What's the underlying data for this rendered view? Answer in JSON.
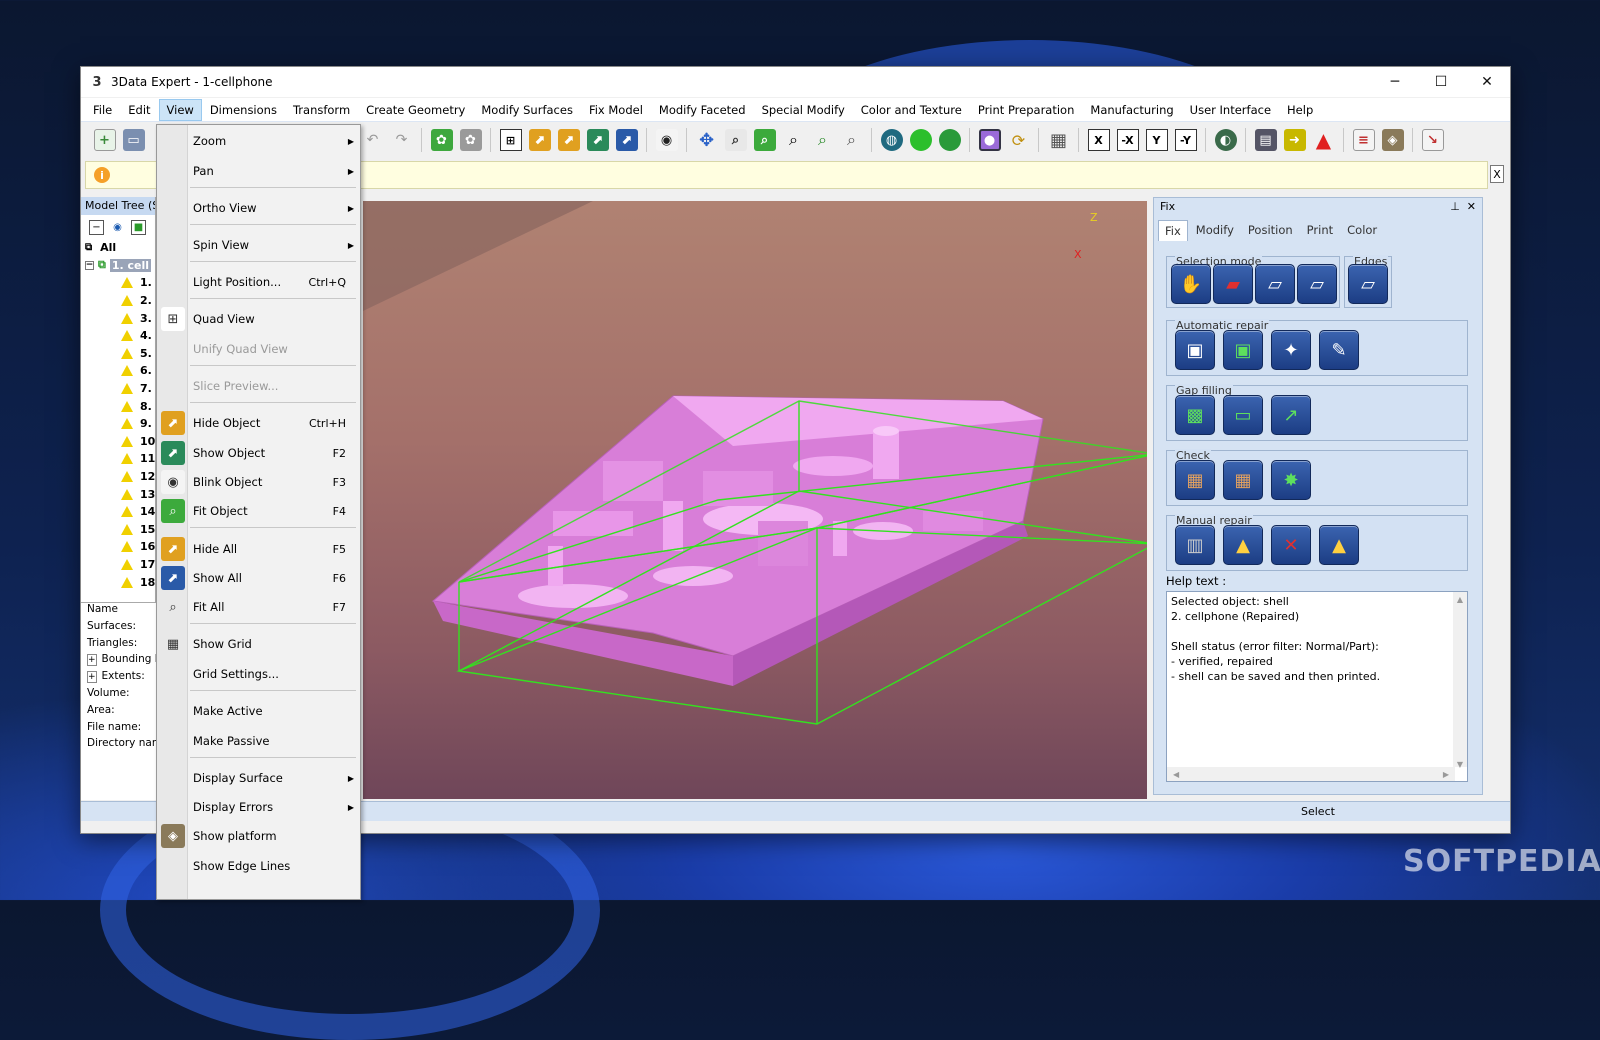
{
  "window": {
    "title": "3Data Expert - 1-cellphone",
    "minimize": "─",
    "maximize": "☐",
    "close": "✕"
  },
  "menu": [
    "File",
    "Edit",
    "View",
    "Dimensions",
    "Transform",
    "Create Geometry",
    "Modify Surfaces",
    "Fix Model",
    "Modify Faceted",
    "Special Modify",
    "Color and Texture",
    "Print Preparation",
    "Manufacturing",
    "User Interface",
    "Help"
  ],
  "toolbar": {
    "x": "X",
    "neg_x": "-X",
    "y": "Y",
    "neg_y": "-Y"
  },
  "infobar": {
    "icon": "i",
    "close": "X"
  },
  "tree": {
    "header": "Model Tree (Sh",
    "root": "All",
    "model": "1. cell",
    "items": [
      "1.",
      "2.",
      "3.",
      "4.",
      "5.",
      "6.",
      "7.",
      "8.",
      "9.",
      "10",
      "11",
      "12",
      "13",
      "14",
      "15",
      "16",
      "17",
      "18"
    ]
  },
  "properties": [
    "Name",
    "Surfaces:",
    "Triangles:",
    "Bounding b",
    "Extents:",
    "Volume:",
    "Area:",
    "File name:",
    "Directory name"
  ],
  "view_menu": [
    {
      "label": "Zoom",
      "submenu": true
    },
    {
      "label": "Pan",
      "submenu": true
    },
    {
      "label": "Ortho View",
      "submenu": true
    },
    {
      "label": "Spin View",
      "submenu": true
    },
    {
      "label": "Light Position...",
      "shortcut": "Ctrl+Q"
    },
    {
      "label": "Quad View",
      "icon": "quad-view-icon"
    },
    {
      "label": "Unify Quad View",
      "disabled": true
    },
    {
      "label": "Slice Preview...",
      "disabled": true
    },
    {
      "label": "Hide Object",
      "shortcut": "Ctrl+H",
      "icon": "hide-object-icon"
    },
    {
      "label": "Show Object",
      "shortcut": "F2",
      "icon": "show-object-icon"
    },
    {
      "label": "Blink Object",
      "shortcut": "F3",
      "icon": "blink-eye-icon"
    },
    {
      "label": "Fit Object",
      "shortcut": "F4",
      "icon": "fit-object-icon"
    },
    {
      "label": "Hide All",
      "shortcut": "F5",
      "icon": "hide-all-icon"
    },
    {
      "label": "Show All",
      "shortcut": "F6",
      "icon": "show-all-icon"
    },
    {
      "label": "Fit All",
      "shortcut": "F7",
      "icon": "fit-all-icon"
    },
    {
      "label": "Show Grid",
      "icon": "grid-icon"
    },
    {
      "label": "Grid Settings..."
    },
    {
      "label": "Make Active"
    },
    {
      "label": "Make Passive"
    },
    {
      "label": "Display Surface",
      "submenu": true
    },
    {
      "label": "Display Errors",
      "submenu": true
    },
    {
      "label": "Show platform",
      "icon": "platform-icon"
    },
    {
      "label": "Show Edge Lines"
    }
  ],
  "fix_panel": {
    "title": "Fix",
    "tabs": [
      "Fix",
      "Modify",
      "Position",
      "Print",
      "Color"
    ],
    "groups": {
      "selection_mode": "Selection mode",
      "edges": "Edges",
      "automatic_repair": "Automatic repair",
      "gap_filling": "Gap filling",
      "check": "Check",
      "manual_repair": "Manual repair"
    },
    "help_label": "Help text :",
    "help_lines": [
      "Selected object: shell",
      "2. cellphone (Repaired)",
      "",
      "Shell status (error filter: Normal/Part):",
      "- verified, repaired",
      "- shell can be saved and then printed."
    ]
  },
  "axes": {
    "z": "Z",
    "x": "X"
  },
  "status": {
    "mode": "Select"
  },
  "watermark": "SOFTPEDIA",
  "colors": {
    "model": "#e48fe6",
    "bbox": "#33e21f",
    "viewport_top": "#b08272",
    "viewport_bottom": "#6f4659"
  }
}
